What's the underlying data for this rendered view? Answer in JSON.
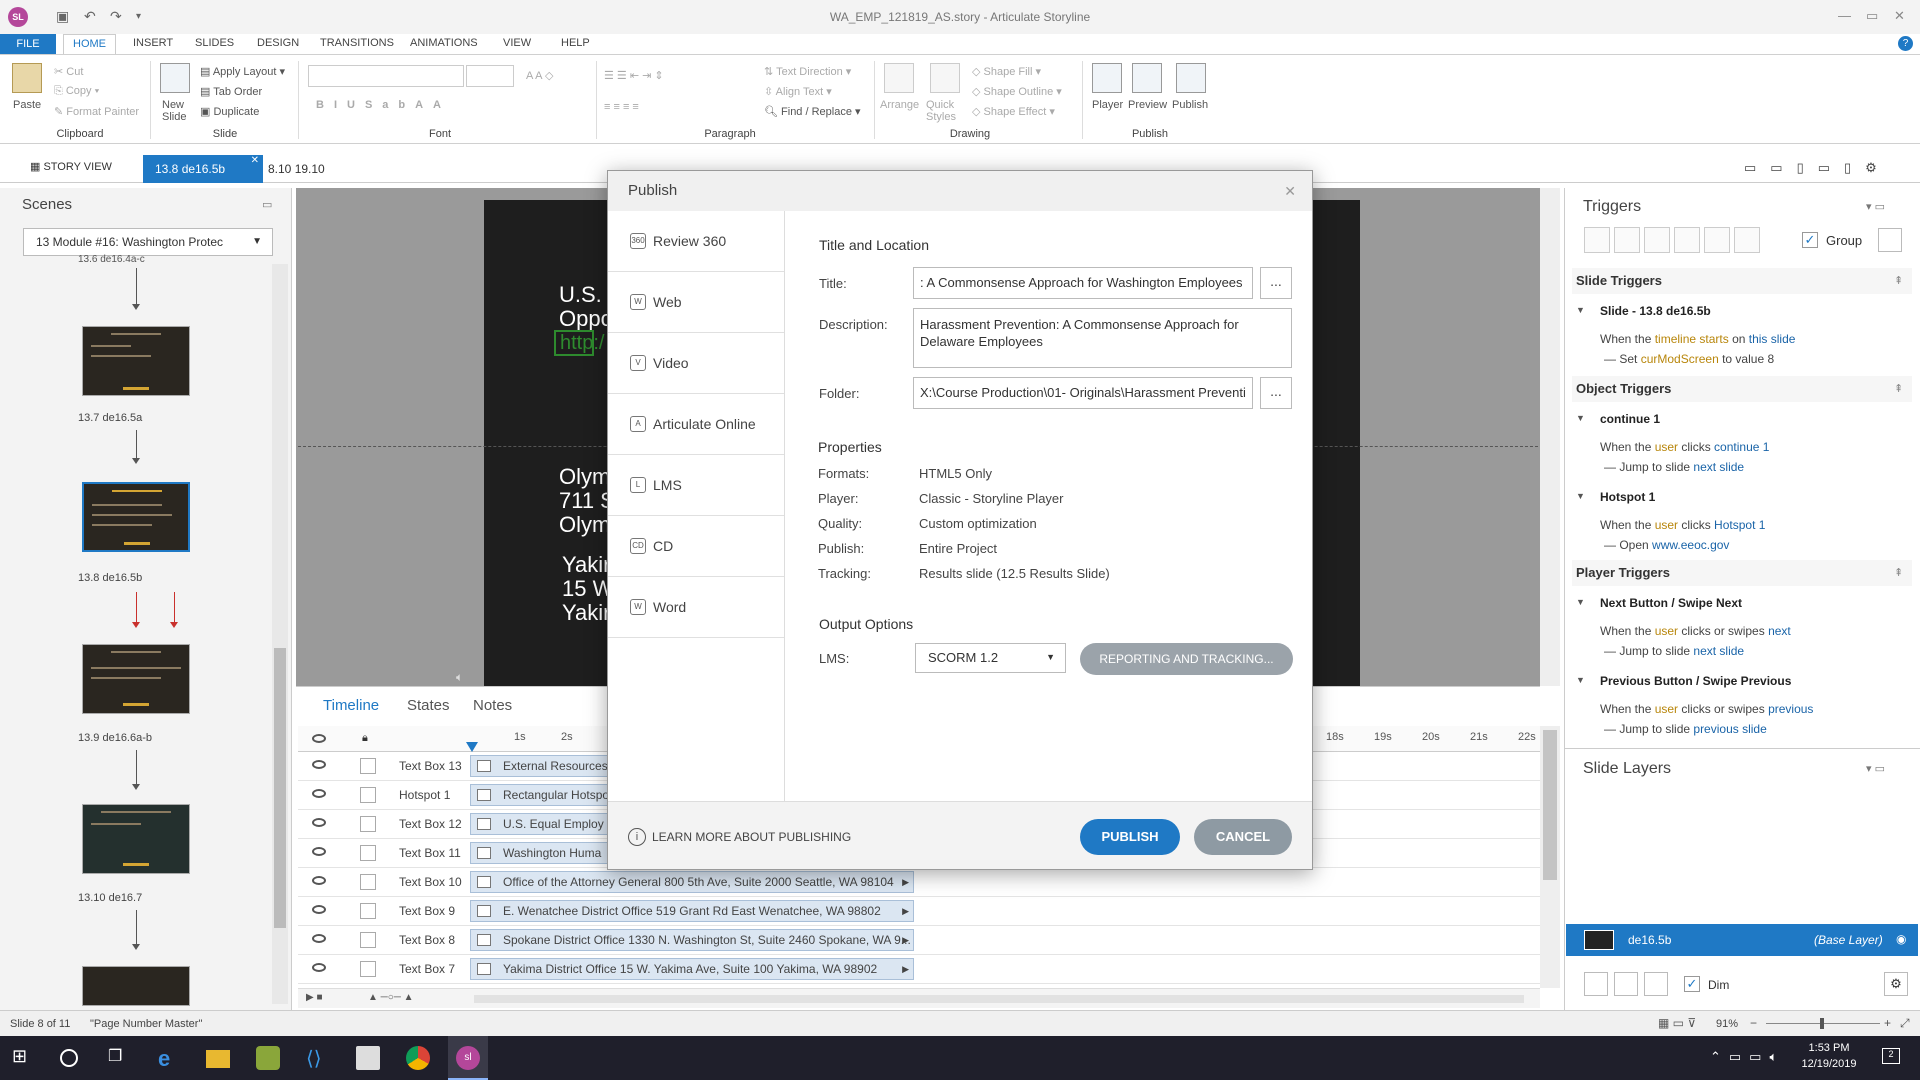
{
  "app": {
    "window_title": "WA_EMP_121819_AS.story - Articulate Storyline",
    "logo": "SL"
  },
  "ribbon_tabs": [
    "FILE",
    "HOME",
    "INSERT",
    "SLIDES",
    "DESIGN",
    "TRANSITIONS",
    "ANIMATIONS",
    "VIEW",
    "HELP"
  ],
  "ribbon": {
    "clipboard": {
      "paste": "Paste",
      "cut": "Cut",
      "copy": "Copy",
      "format_painter": "Format Painter",
      "label": "Clipboard"
    },
    "slide": {
      "new_slide": "New Slide",
      "apply_layout": "Apply Layout",
      "tab_order": "Tab Order",
      "duplicate": "Duplicate",
      "label": "Slide"
    },
    "font": {
      "label": "Font"
    },
    "paragraph": {
      "text_direction": "Text Direction",
      "align_text": "Align Text",
      "find_replace": "Find / Replace",
      "label": "Paragraph"
    },
    "drawing": {
      "arrange": "Arrange",
      "quick_styles": "Quick Styles",
      "shape_fill": "Shape Fill",
      "shape_outline": "Shape Outline",
      "shape_effect": "Shape Effect",
      "label": "Drawing"
    },
    "publish": {
      "player": "Player",
      "preview": "Preview",
      "publish": "Publish",
      "label": "Publish"
    }
  },
  "tabs": {
    "story_view": "STORY VIEW",
    "active": "13.8 de16.5b",
    "other": "8.10 19.10"
  },
  "scenes": {
    "title": "Scenes",
    "selected": "13 Module #16: Washington Protec",
    "top_label": "13.6 de16.4a-c",
    "thumbs": [
      {
        "label": "13.7 de16.5a"
      },
      {
        "label": "13.8 de16.5b"
      },
      {
        "label": "13.9 de16.6a-b"
      },
      {
        "label": "13.10 de16.7"
      }
    ]
  },
  "slide_text": {
    "line1": "U.S.",
    "line2": "Oppo",
    "link": "http:/",
    "l3": "Olym",
    "l4": "711 S",
    "l5": "Olym",
    "l6": "Yakir",
    "l7": "15 W",
    "l8": "Yakir"
  },
  "timeline": {
    "tabs": [
      "Timeline",
      "States",
      "Notes"
    ],
    "ticks_left": [
      "1s",
      "2s"
    ],
    "ticks_right": [
      "18s",
      "19s",
      "20s",
      "21s",
      "22s"
    ],
    "rows": [
      {
        "name": "Text Box 13",
        "bar": "External Resources"
      },
      {
        "name": "Hotspot 1",
        "bar": "Rectangular Hotspo"
      },
      {
        "name": "Text Box 12",
        "bar": "U.S. Equal Employ"
      },
      {
        "name": "Text Box 11",
        "bar": "Washington Huma"
      },
      {
        "name": "Text Box 10",
        "bar": "Office of the Attorney General 800 5th Ave, Suite 2000 Seattle, WA 98104"
      },
      {
        "name": "Text Box 9",
        "bar": "E. Wenatchee District Office 519 Grant Rd East Wenatchee, WA 98802"
      },
      {
        "name": "Text Box 8",
        "bar": "Spokane District Office 1330 N. Washington St, Suite 2460 Spokane, WA 9..."
      },
      {
        "name": "Text Box 7",
        "bar": "Yakima District Office 15 W. Yakima Ave, Suite 100 Yakima, WA 98902"
      }
    ]
  },
  "triggers": {
    "title": "Triggers",
    "group": "Group",
    "slide_triggers": "Slide Triggers",
    "slide_name": "Slide - 13.8 de16.5b",
    "st_when_a": "When the ",
    "st_when_b": "timeline starts",
    "st_when_c": " on ",
    "st_when_d": "this slide",
    "st_set_a": "Set ",
    "st_set_b": "curModScreen",
    "st_set_c": " to value 8",
    "object_triggers": "Object Triggers",
    "continue": "continue 1",
    "c_when_a": "When the ",
    "c_when_b": "user",
    "c_when_c": " clicks ",
    "c_when_d": "continue 1",
    "c_jump_a": "Jump to slide ",
    "c_jump_b": "next slide",
    "hotspot": "Hotspot 1",
    "h_when_a": "When the ",
    "h_when_b": "user",
    "h_when_c": " clicks ",
    "h_when_d": "Hotspot 1",
    "h_open_a": "Open ",
    "h_open_b": "www.eeoc.gov",
    "player_triggers": "Player Triggers",
    "next_btn": "Next Button / Swipe Next",
    "n_when_a": "When the ",
    "n_when_b": "user",
    "n_when_c": " clicks or swipes ",
    "n_when_d": "next",
    "n_jump_a": "Jump to slide ",
    "n_jump_b": "next slide",
    "prev_btn": "Previous Button / Swipe Previous",
    "p_when_a": "When the ",
    "p_when_b": "user",
    "p_when_c": " clicks or swipes ",
    "p_when_d": "previous",
    "p_jump_a": "Jump to slide ",
    "p_jump_b": "previous slide"
  },
  "layers": {
    "title": "Slide Layers",
    "base_name": "de16.5b",
    "base_tag": "(Base Layer)",
    "dim": "Dim"
  },
  "status": {
    "slide": "Slide 8 of 11",
    "master": "\"Page Number Master\"",
    "zoom": "91%"
  },
  "taskbar": {
    "time": "1:53 PM",
    "date": "12/19/2019",
    "notif": "2",
    "app": "sl"
  },
  "publish_dialog": {
    "title": "Publish",
    "nav": [
      {
        "icon": "360",
        "label": "Review 360"
      },
      {
        "icon": "W",
        "label": "Web"
      },
      {
        "icon": "V",
        "label": "Video"
      },
      {
        "icon": "A",
        "label": "Articulate Online"
      },
      {
        "icon": "L",
        "label": "LMS"
      },
      {
        "icon": "CD",
        "label": "CD"
      },
      {
        "icon": "W",
        "label": "Word"
      }
    ],
    "title_location": "Title and Location",
    "title_label": "Title:",
    "title_value": ": A Commonsense Approach for Washington Employees",
    "desc_label": "Description:",
    "desc_value": "Harassment Prevention: A Commonsense Approach for Delaware Employees",
    "folder_label": "Folder:",
    "folder_value": "X:\\Course Production\\01- Originals\\Harassment Preventi",
    "browse": "...",
    "properties": "Properties",
    "props": [
      {
        "k": "Formats:",
        "v": "HTML5 Only"
      },
      {
        "k": "Player:",
        "v": "Classic - Storyline Player"
      },
      {
        "k": "Quality:",
        "v": "Custom optimization"
      },
      {
        "k": "Publish:",
        "v": "Entire Project"
      },
      {
        "k": "Tracking:",
        "v": "Results slide (12.5 Results Slide)"
      }
    ],
    "output_options": "Output Options",
    "lms_label": "LMS:",
    "lms_value": "SCORM 1.2",
    "reporting": "REPORTING AND TRACKING...",
    "learn_more": "LEARN MORE ABOUT PUBLISHING",
    "publish_btn": "PUBLISH",
    "cancel_btn": "CANCEL"
  },
  "colors": {
    "accent": "#1f79c5",
    "cancel": "#8e9aa3",
    "reporting": "#9ba3aa"
  }
}
